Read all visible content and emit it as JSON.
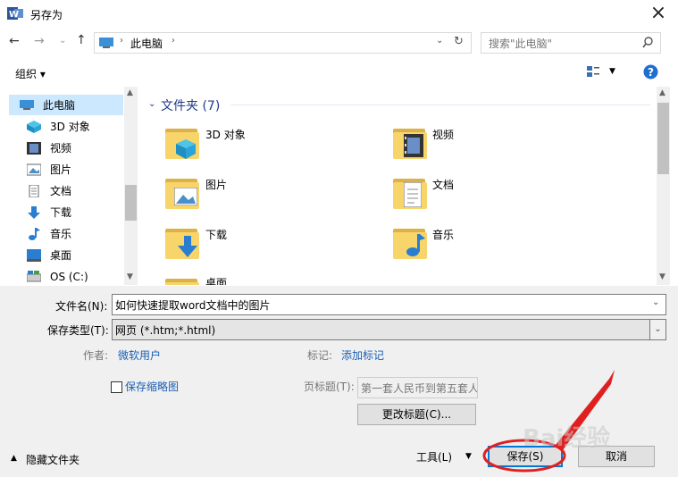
{
  "window": {
    "title": "另存为"
  },
  "address": {
    "crumb": "此电脑",
    "search_placeholder": "搜索\"此电脑\""
  },
  "toolbar": {
    "organize": "组织 ▾"
  },
  "nav": {
    "items": [
      {
        "label": "此电脑",
        "icon": "computer-icon"
      },
      {
        "label": "3D 对象",
        "icon": "3d-objects-icon"
      },
      {
        "label": "视频",
        "icon": "video-icon"
      },
      {
        "label": "图片",
        "icon": "pictures-icon"
      },
      {
        "label": "文档",
        "icon": "documents-icon"
      },
      {
        "label": "下载",
        "icon": "download-icon"
      },
      {
        "label": "音乐",
        "icon": "music-icon"
      },
      {
        "label": "桌面",
        "icon": "desktop-icon"
      },
      {
        "label": "OS (C:)",
        "icon": "drive-icon"
      }
    ]
  },
  "content": {
    "group_header": "文件夹 (7)",
    "folders": [
      {
        "label": "3D 对象"
      },
      {
        "label": "视频"
      },
      {
        "label": "图片"
      },
      {
        "label": "文档"
      },
      {
        "label": "下载"
      },
      {
        "label": "音乐"
      },
      {
        "label": "桌面"
      }
    ]
  },
  "form": {
    "filename_label": "文件名(N):",
    "filename_value": "如何快速提取word文档中的图片",
    "filetype_label": "保存类型(T):",
    "filetype_value": "网页 (*.htm;*.html)",
    "author_label": "作者:",
    "author_value": "微软用户",
    "tags_label": "标记:",
    "tags_value": "添加标记",
    "thumbnail_label": "保存缩略图",
    "page_title_label": "页标题(T):",
    "page_title_value": "第一套人民币到第五套人",
    "change_title_button": "更改标题(C)...",
    "hide_folders": "隐藏文件夹",
    "tools": "工具(L)",
    "save": "保存(S)",
    "cancel": "取消"
  },
  "watermark": {
    "text": "Bai经验"
  },
  "colors": {
    "accent": "#0078d7",
    "selection": "#cce8ff",
    "annotation": "#e02020"
  }
}
